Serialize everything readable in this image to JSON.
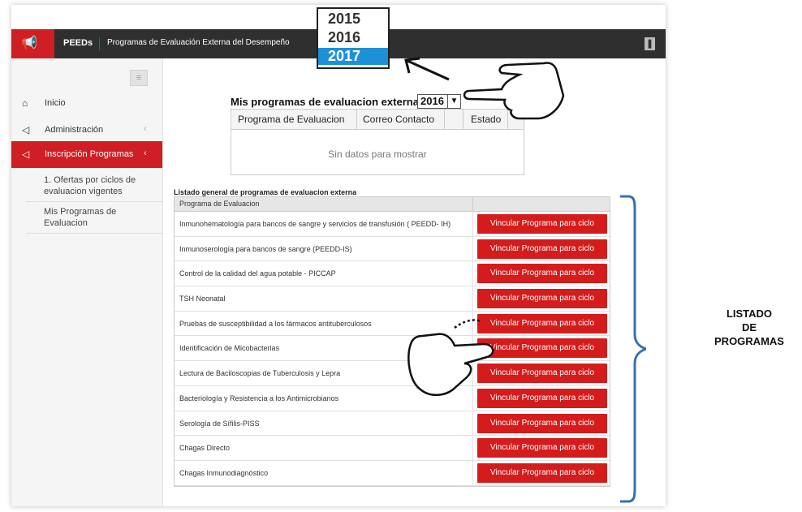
{
  "app": {
    "name": "PEEDs",
    "title": "Programas de Evaluación Externa del Desempeño"
  },
  "sidebar": {
    "items": [
      {
        "label": "Inicio"
      },
      {
        "label": "Administración"
      },
      {
        "label": "Inscripción Programas"
      }
    ],
    "sub_items": [
      {
        "label": "1. Ofertas por ciclos de evaluacion vigentes"
      },
      {
        "label": "Mis Programas de Evaluacion"
      }
    ]
  },
  "mis_programas": {
    "label": "Mis programas de evaluacion externa",
    "year_selected": "2016",
    "columns": [
      "Programa de Evaluacion",
      "Correo Contacto",
      "",
      "Estado"
    ],
    "empty_text": "Sin datos para mostrar"
  },
  "year_popup": {
    "options": [
      "2015",
      "2016",
      "2017"
    ],
    "highlighted": "2017"
  },
  "listado": {
    "title": "Listado general de programas de evaluacion externa",
    "column_header": "Programa de Evaluacion",
    "button_label": "Vincular Programa para ciclo",
    "rows": [
      "Inmunohematología para bancos de sangre y servicios de transfusión ( PEEDD- IH)",
      "Inmunoserología para bancos de sangre (PEEDD-IS)",
      "Control de la calidad del agua potable - PICCAP",
      "TSH Neonatal",
      "Pruebas de susceptibilidad a los fármacos antituberculosos",
      "Identificación de Micobacterias",
      "Lectura de Baciloscopias de Tuberculosis y Lepra",
      "Bacteriología y Resistencia a los Antimicrobianos",
      "Serología de Sífilis-PISS",
      "Chagas Directo",
      "Chagas Inmunodiagnóstico"
    ]
  },
  "annotation": {
    "line1": "LISTADO",
    "line2": "DE",
    "line3": "PROGRAMAS"
  },
  "colors": {
    "brand_red": "#d01f24",
    "topbar": "#2f2f2f",
    "button_red": "#d41c1c",
    "highlight_blue": "#1e90d8"
  }
}
